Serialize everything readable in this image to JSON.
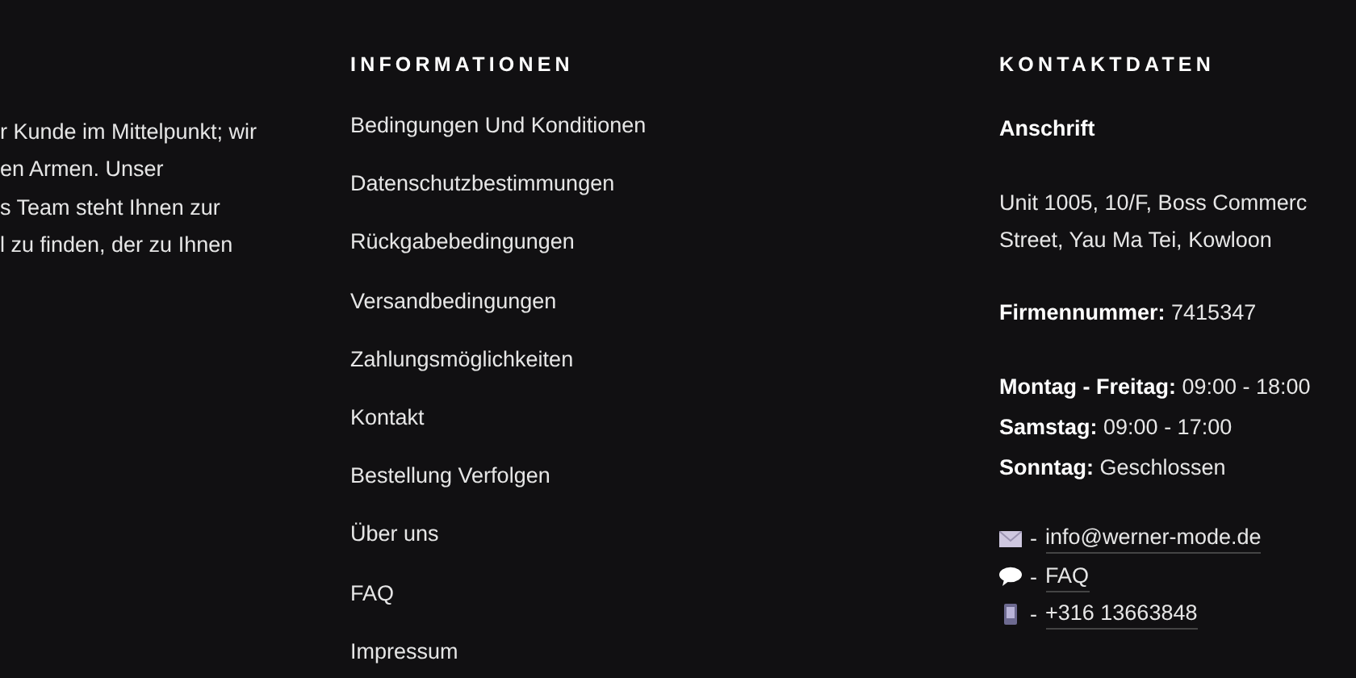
{
  "about": {
    "lines": [
      "r Kunde im Mittelpunkt; wir",
      "en Armen. Unser",
      "s Team steht Ihnen zur",
      "l zu finden, der zu Ihnen"
    ]
  },
  "information": {
    "heading": "INFORMATIONEN",
    "links": [
      "Bedingungen Und Konditionen",
      "Datenschutzbestimmungen",
      "Rückgabebedingungen",
      "Versandbedingungen",
      "Zahlungsmöglichkeiten",
      "Kontakt",
      "Bestellung Verfolgen",
      "Über uns",
      "FAQ",
      "Impressum"
    ]
  },
  "contact": {
    "heading": "KONTAKTDATEN",
    "address_label": "Anschrift",
    "address_lines": [
      "Unit 1005, 10/F, Boss Commerc",
      "Street, Yau Ma Tei, Kowloon"
    ],
    "company_number": "**Firmennummer:** 7415347",
    "hours": [
      "**Montag - Freitag:** 09:00 - 18:00",
      "**Samstag:** 09:00 - 17:00",
      "**Sonntag:** Geschlossen"
    ],
    "channels": [
      {
        "kind": "email",
        "prefix": "-",
        "text": "info@werner-mode.de"
      },
      {
        "kind": "chat",
        "prefix": "-",
        "text": "FAQ"
      },
      {
        "kind": "phone",
        "prefix": "-",
        "text": "+316 13663848"
      }
    ]
  }
}
